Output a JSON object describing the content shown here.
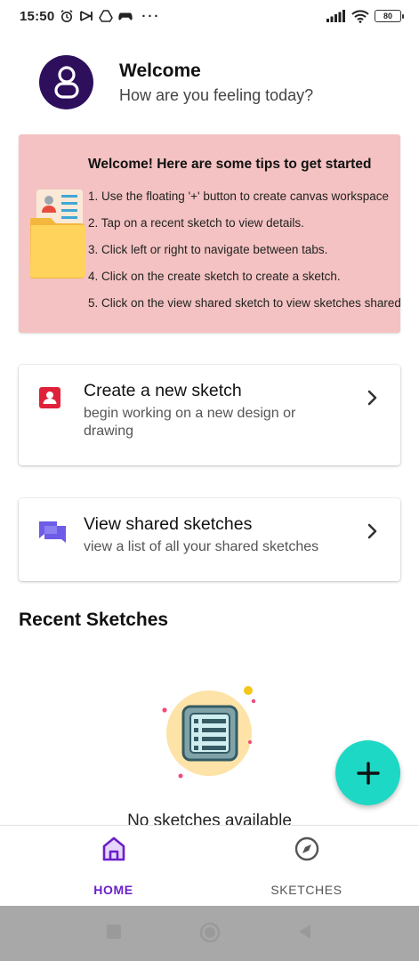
{
  "status_bar": {
    "time": "15:50",
    "dots": "···",
    "battery": "80"
  },
  "header": {
    "title": "Welcome",
    "subtitle": "How are you feeling today?"
  },
  "tips": {
    "title": "Welcome! Here are some tips to get started",
    "items": [
      "1. Use the floating '+' button to create canvas workspace",
      "2. Tap on a recent sketch to view details.",
      "3. Click left or right to navigate between tabs.",
      "4. Click on the create sketch to create a sketch.",
      "5. Click on the view shared sketch to view sketches shared"
    ]
  },
  "cards": {
    "create": {
      "title": "Create a new sketch",
      "description": "begin working on a new design or drawing",
      "icon": "contact-card-icon",
      "icon_color": "#e0213a"
    },
    "view": {
      "title": "View shared sketches",
      "description": "view a list of all your shared sketches",
      "icon": "chat-bubbles-icon",
      "icon_color": "#6c5ce7"
    }
  },
  "recent": {
    "title": "Recent Sketches",
    "empty_text": "No sketches available"
  },
  "fab": {
    "icon": "plus-icon",
    "color": "#1dd8c4"
  },
  "bottom_nav": {
    "items": [
      {
        "label": "HOME",
        "icon": "home-icon",
        "active": true
      },
      {
        "label": "SKETCHES",
        "icon": "compass-icon",
        "active": false
      }
    ],
    "active_color": "#6a1fc9"
  },
  "colors": {
    "avatar_bg": "#2e0f5c",
    "tips_bg": "#f4c2c2"
  }
}
